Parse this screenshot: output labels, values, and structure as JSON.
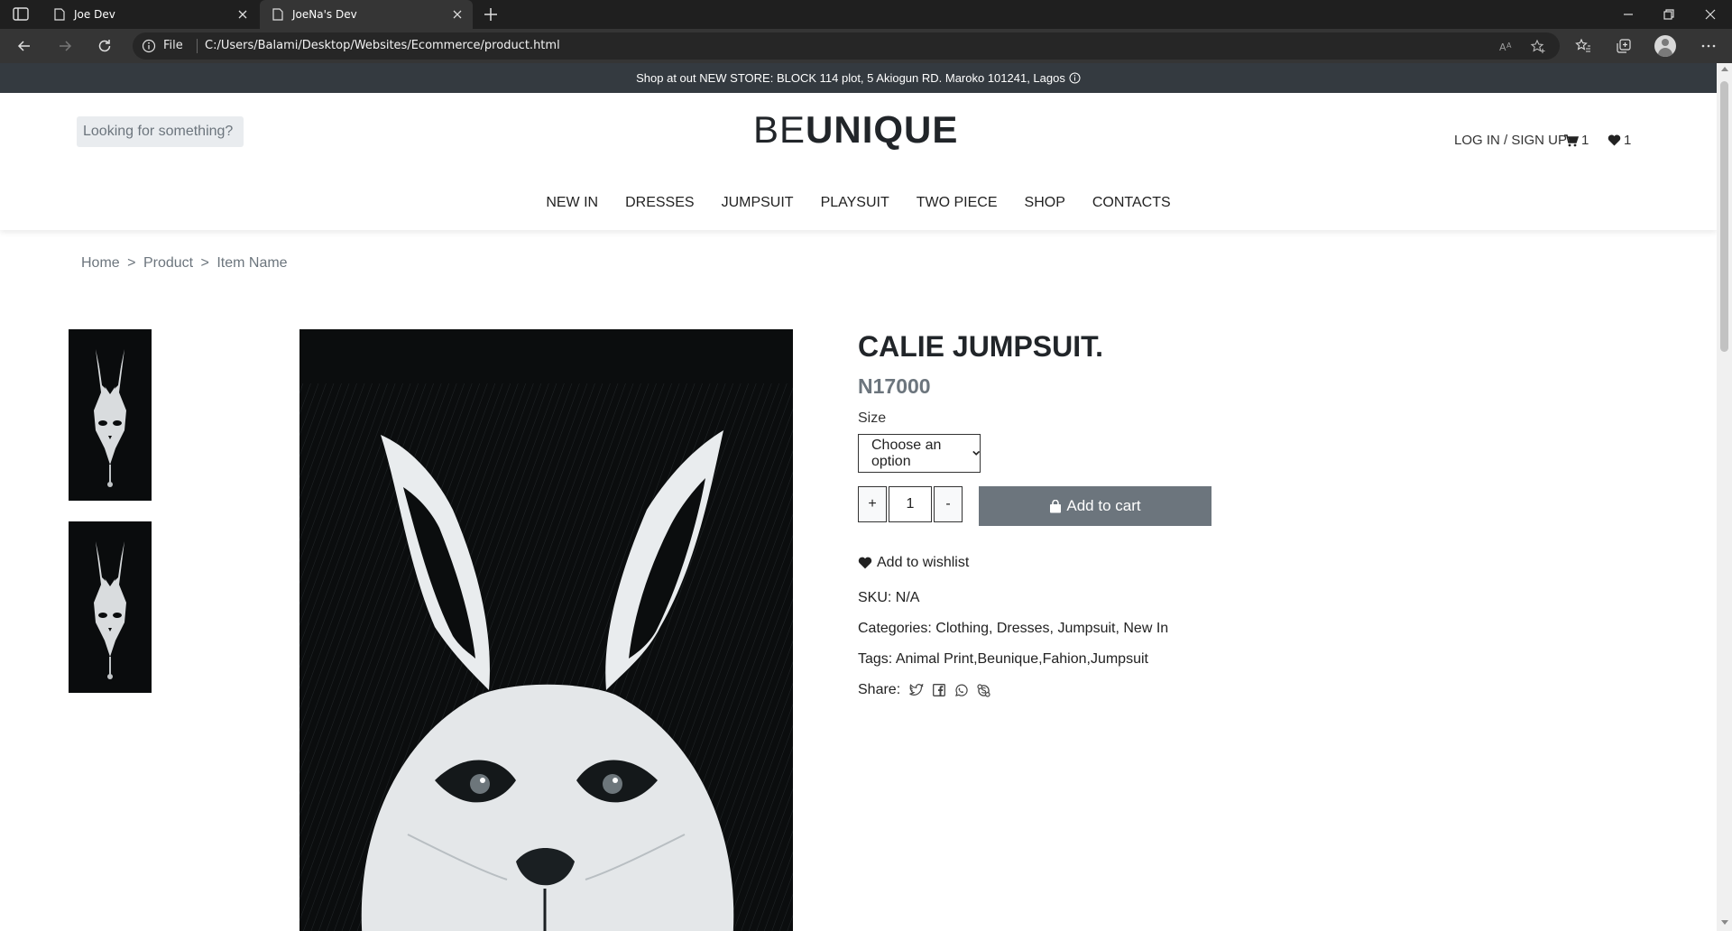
{
  "browser": {
    "tabs": [
      {
        "title": "Joe Dev",
        "icon": "page-icon"
      },
      {
        "title": "JoeNa's Dev",
        "icon": "page-icon"
      }
    ],
    "address": {
      "security_label": "File",
      "url": "C:/Users/Balami/Desktop/Websites/Ecommerce/product.html"
    }
  },
  "promo": {
    "text": "Shop at out NEW STORE: BLOCK 114 plot, 5 Akiogun RD. Maroko 101241, Lagos"
  },
  "header": {
    "search_placeholder": "Looking for something?",
    "logo_light": "BE",
    "logo_bold": "UNIQUE",
    "login_label": "LOG IN / SIGN UP",
    "cart_count": "1",
    "wishlist_count": "1"
  },
  "nav": [
    "NEW IN",
    "DRESSES",
    "JUMPSUIT",
    "PLAYSUIT",
    "TWO PIECE",
    "SHOP",
    "CONTACTS"
  ],
  "breadcrumb": [
    "Home",
    ">",
    "Product",
    ">",
    "Item Name"
  ],
  "product": {
    "title": "CALIE JUMPSUIT.",
    "price": "N17000",
    "size_label": "Size",
    "size_selected": "Choose an option",
    "qty_plus": "+",
    "qty_value": "1",
    "qty_minus": "-",
    "add_to_cart": "Add to cart",
    "add_to_wishlist": "Add to wishlist",
    "sku": "SKU: N/A",
    "categories_label": "Categories:",
    "categories": "Clothing, Dresses, Jumpsuit, New In",
    "tags_label": "Tags:",
    "tags": "Animal Print,Beunique,Fahion,Jumpsuit",
    "share_label": "Share:",
    "share_icons": [
      "twitter-icon",
      "facebook-icon",
      "whatsapp-icon",
      "skype-icon"
    ]
  },
  "colors": {
    "promo_bg": "#343a40",
    "price": "#6c757d",
    "button_bg": "#6c757d"
  }
}
